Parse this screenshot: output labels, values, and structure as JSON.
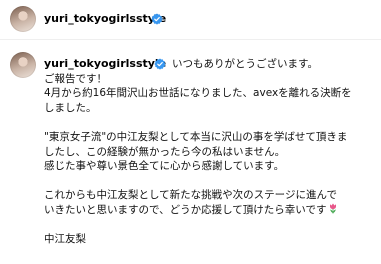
{
  "header": {
    "username": "yuri_tokyogirlsstyle"
  },
  "post": {
    "username": "yuri_tokyogirlsstyle",
    "lines": [
      "いつもありがとうございます。",
      "ご報告です！",
      "4月から約16年間沢山お世話になりました、avexを離れる決断を",
      "しました。",
      "",
      "\"東京女子流\"の中江友梨として本当に沢山の事を学ばせて頂きま",
      "したし、この経験が無かったら今の私はいません。",
      "感じた事や尊い景色全てに心から感謝しています。",
      "",
      "これからも中江友梨として新たな挑戦や次のステージに進んで",
      "いきたいと思いますので、どうか応援して頂けたら幸いです",
      "",
      "中江友梨"
    ],
    "emoji_icon": "tulip-icon",
    "colors": {
      "verified": "#3897f0",
      "tulip_petal": "#e8578a",
      "tulip_leaf": "#3ea34a"
    }
  }
}
